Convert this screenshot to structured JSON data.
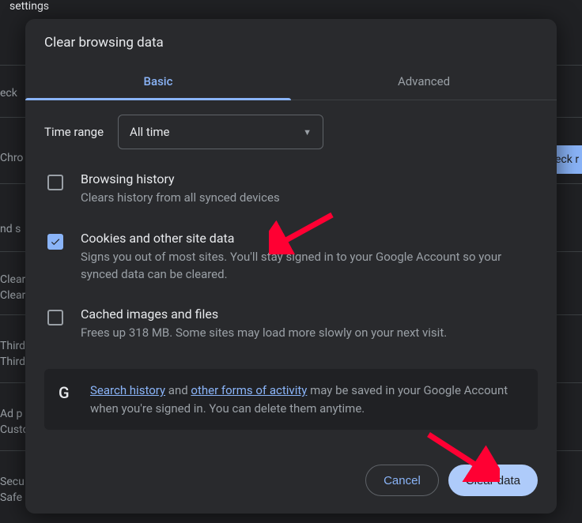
{
  "bg": {
    "top": "settings",
    "eck": "eck",
    "chro": "Chro",
    "nds": "nd s",
    "eckr": "eck r",
    "clear1": "Clear",
    "clear2": "Clear",
    "third1": "Third",
    "third2": "Third",
    "adp": "Ad p",
    "custo": "Custo",
    "secu": "Secu",
    "safe": "Safe"
  },
  "dialog": {
    "title": "Clear browsing data",
    "tabs": {
      "basic": "Basic",
      "advanced": "Advanced"
    },
    "time_range_label": "Time range",
    "time_range_value": "All time",
    "options": [
      {
        "id": "history",
        "checked": false,
        "title": "Browsing history",
        "desc": "Clears history from all synced devices"
      },
      {
        "id": "cookies",
        "checked": true,
        "title": "Cookies and other site data",
        "desc": "Signs you out of most sites. You'll stay signed in to your Google Account so your synced data can be cleared."
      },
      {
        "id": "cache",
        "checked": false,
        "title": "Cached images and files",
        "desc": "Frees up 318 MB. Some sites may load more slowly on your next visit."
      }
    ],
    "info": {
      "link1": "Search history",
      "mid1": " and ",
      "link2": "other forms of activity",
      "rest": " may be saved in your Google Account when you're signed in. You can delete them anytime."
    },
    "buttons": {
      "cancel": "Cancel",
      "confirm": "Clear data"
    }
  },
  "annotation": {
    "arrow_color": "#ff0033"
  }
}
